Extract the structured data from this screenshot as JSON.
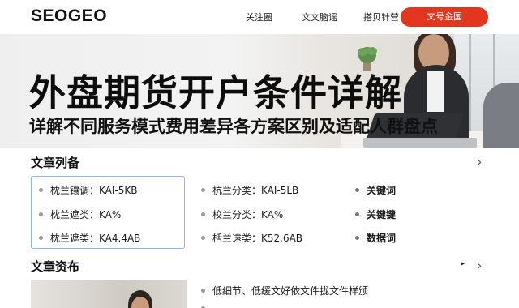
{
  "header": {
    "logo": "SEOGEO",
    "nav": [
      "关注圈",
      "文文脑谣",
      "搭贝针营"
    ],
    "cta_label": "文号金国"
  },
  "hero": {
    "title": "外盘期货开户条件详解",
    "subtitle": "详解不同服务模式费用差异各方案区别及适配人群盘点"
  },
  "article_list": {
    "title": "文章列备",
    "rows": [
      [
        "枕兰镶调：KAI-5KB",
        "杭兰分类：KAI-5LB",
        "关键词"
      ],
      [
        "枕兰遮类：KA%",
        "校兰分类：KA%",
        "关键键"
      ],
      [
        "枕兰遮类：KA4.4AB",
        "栝兰遠类：K52.6AB",
        "数据词"
      ]
    ]
  },
  "article_section2": {
    "title": "文章资布",
    "items": [
      "低细节、低缓文好依文件拢文件样颁",
      ""
    ]
  }
}
